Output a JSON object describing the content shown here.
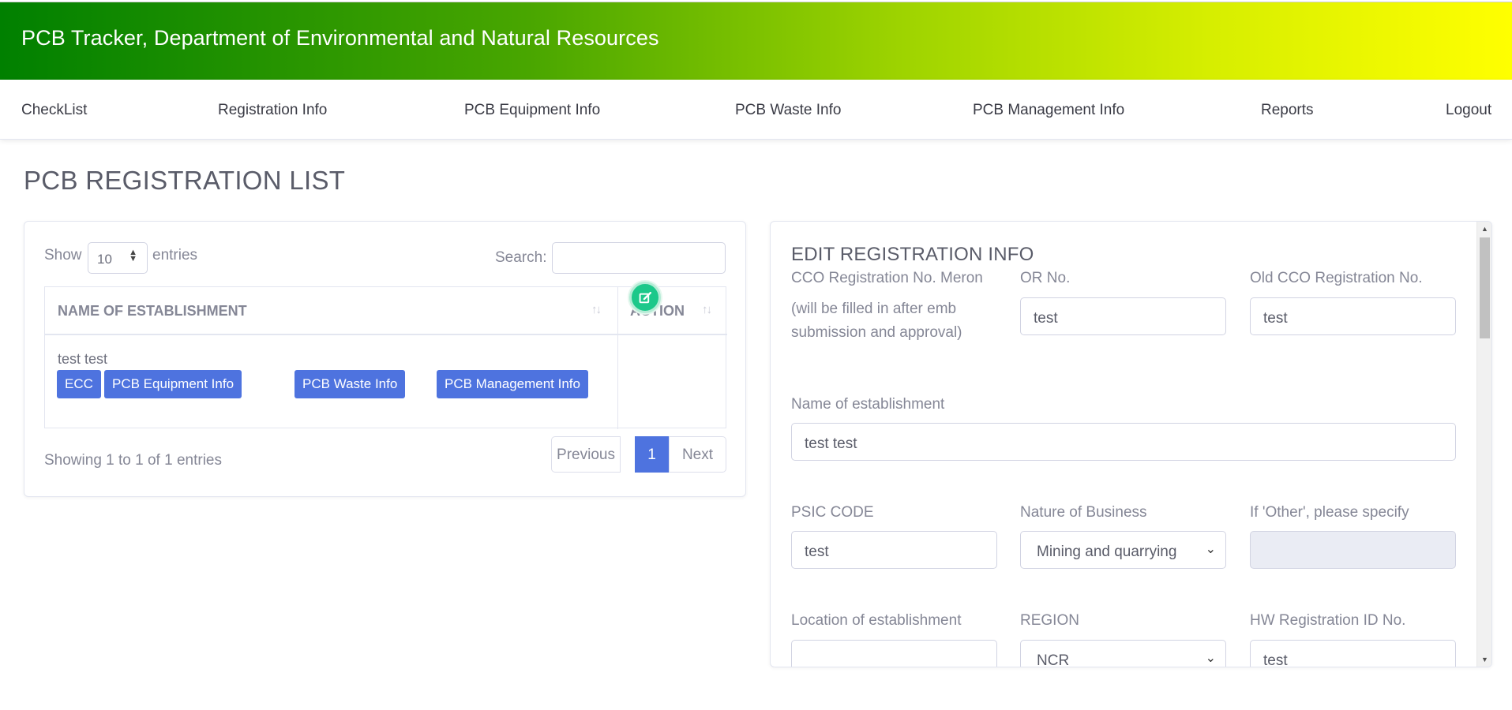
{
  "header": {
    "title": "PCB Tracker, Department of Environmental and Natural Resources"
  },
  "nav": {
    "items": [
      "CheckList",
      "Registration Info",
      "PCB Equipment Info",
      "PCB Waste Info",
      "PCB Management Info",
      "Reports",
      "Logout"
    ]
  },
  "page": {
    "title": "PCB REGISTRATION LIST"
  },
  "list": {
    "show_label": "Show",
    "entries_value": "10",
    "entries_label": "entries",
    "search_label": "Search:",
    "search_value": "",
    "columns": [
      "NAME OF ESTABLISHMENT",
      "ACTION"
    ],
    "rows": [
      {
        "name": "test test",
        "tags": [
          "ECC",
          "PCB Equipment Info",
          "PCB Waste Info",
          "PCB Management Info"
        ]
      }
    ],
    "info": "Showing 1 to 1 of 1 entries",
    "pagination": {
      "previous": "Previous",
      "current": "1",
      "next": "Next"
    }
  },
  "form": {
    "title": "EDIT REGISTRATION INFO",
    "cco_label": "CCO Registration No. Meron",
    "cco_note": "(will be filled in after emb submission and approval)",
    "or_label": "OR No.",
    "or_value": "test",
    "old_cco_label": "Old CCO Registration No.",
    "old_cco_value": "test",
    "name_label": "Name of establishment",
    "name_value": "test test",
    "psic_label": "PSIC CODE",
    "psic_value": "test",
    "nature_label": "Nature of Business",
    "nature_value": "Mining and quarrying",
    "other_label": "If 'Other', please specify",
    "other_value": "",
    "location_label": "Location of establishment",
    "location_value": "",
    "region_label": "REGION",
    "region_value": "NCR",
    "hw_label": "HW Registration ID No.",
    "hw_value": "test"
  },
  "colors": {
    "accent": "#4e73df",
    "success": "#1cc88a",
    "header_start": "#008000",
    "header_end": "#ffff00"
  }
}
